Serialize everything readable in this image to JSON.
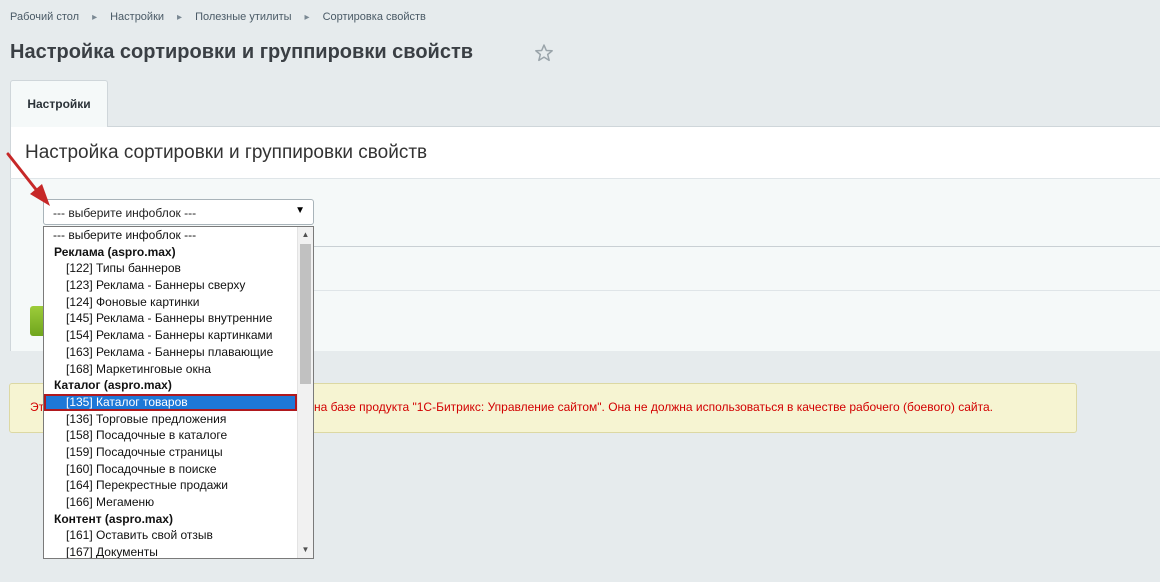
{
  "breadcrumb": [
    {
      "label": "Рабочий стол"
    },
    {
      "label": "Настройки"
    },
    {
      "label": "Полезные утилиты"
    },
    {
      "label": "Сортировка свойств"
    }
  ],
  "page": {
    "title": "Настройка сортировки и группировки свойств",
    "favorite_icon": "star-icon"
  },
  "tabs": [
    {
      "label": "Настройки"
    }
  ],
  "panel": {
    "title": "Настройка сортировки и группировки свойств"
  },
  "iblock_select": {
    "value": "--- выберите инфоблок ---",
    "options": [
      {
        "type": "placeholder",
        "label": "--- выберите инфоблок ---"
      },
      {
        "type": "group",
        "label": "Реклама (aspro.max)"
      },
      {
        "type": "item",
        "label": "[122] Типы баннеров"
      },
      {
        "type": "item",
        "label": "[123] Реклама - Баннеры сверху"
      },
      {
        "type": "item",
        "label": "[124] Фоновые картинки"
      },
      {
        "type": "item",
        "label": "[145] Реклама - Баннеры внутренние"
      },
      {
        "type": "item",
        "label": "[154] Реклама - Баннеры картинками"
      },
      {
        "type": "item",
        "label": "[163] Реклама - Баннеры плавающие"
      },
      {
        "type": "item",
        "label": "[168] Маркетинговые окна"
      },
      {
        "type": "group",
        "label": "Каталог (aspro.max)"
      },
      {
        "type": "item",
        "label": "[135] Каталог товаров",
        "selected": true
      },
      {
        "type": "item",
        "label": "[136] Торговые предложения"
      },
      {
        "type": "item",
        "label": "[158] Посадочные в каталоге"
      },
      {
        "type": "item",
        "label": "[159] Посадочные страницы"
      },
      {
        "type": "item",
        "label": "[160] Посадочные в поиске"
      },
      {
        "type": "item",
        "label": "[164] Перекрестные продажи"
      },
      {
        "type": "item",
        "label": "[166] Мегаменю"
      },
      {
        "type": "group",
        "label": "Контент (aspro.max)"
      },
      {
        "type": "item",
        "label": "[161] Оставить свой отзыв"
      },
      {
        "type": "item",
        "label": "[167] Документы"
      }
    ]
  },
  "warning": {
    "prefix": "Эт",
    "text": "на базе продукта \"1С-Битрикс: Управление сайтом\". Она не должна использоваться в качестве рабочего (боевого) сайта."
  },
  "colors": {
    "accent_arrow": "#c62828",
    "selection": "#1e78d7",
    "warning_text": "#d20000"
  }
}
